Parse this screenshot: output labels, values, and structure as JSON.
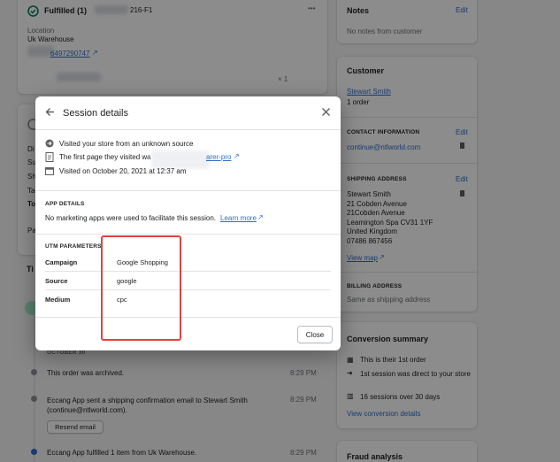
{
  "background": {
    "fulfilled": {
      "title": "Fulfilled (1)",
      "order_suffix": "216-F1",
      "location_label": "Location",
      "location_value": "Uk Warehouse",
      "tracking": "6497290747",
      "qty": "× 1",
      "more": "•••"
    },
    "left_partial_labels": [
      "Di",
      "Su",
      "Sh",
      "Ta",
      "To",
      "Pa"
    ],
    "timeline_heading_partial": "Ti",
    "timeline": {
      "date": "OCTOBER 30",
      "events": [
        {
          "text": "This order was archived.",
          "time": "8:29 PM"
        },
        {
          "text": "Eccang App sent a shipping confirmation email to Stewart Smith (continue@ntlworld.com).",
          "time": "8:29 PM"
        },
        {
          "text": "Eccang App fulfilled 1 item from Uk Warehouse.",
          "time": "8:29 PM"
        }
      ],
      "resend_button": "Resend email"
    },
    "notes": {
      "title": "Notes",
      "edit": "Edit",
      "empty": "No notes from customer"
    },
    "customer": {
      "title": "Customer",
      "name": "Stewart Smith",
      "orders": "1 order",
      "contact_header": "CONTACT INFORMATION",
      "contact_edit": "Edit",
      "email": "continue@ntlworld.com",
      "shipping_header": "SHIPPING ADDRESS",
      "shipping_edit": "Edit",
      "address": [
        "Stewart Smith",
        "21 Cobden Avenue",
        "21Cobden Avenue",
        "Leamington Spa CV31 1YF",
        "United Kingdom",
        "07486 867456"
      ],
      "view_map": "View map",
      "billing_header": "BILLING ADDRESS",
      "billing_value": "Same as shipping address"
    },
    "conversion": {
      "title": "Conversion summary",
      "items": [
        "This is their 1st order",
        "1st session was direct to your store",
        "16 sessions over 30 days"
      ],
      "link": "View conversion details"
    },
    "fraud": {
      "title": "Fraud analysis"
    }
  },
  "modal": {
    "title": "Session details",
    "visit_source": "Visited your store from an unknown source",
    "first_page_prefix": "The first page they visited wa",
    "first_page_suffix": "arer-pro",
    "visited_on": "Visited on October 20, 2021 at 12:37 am",
    "app_details_header": "APP DETAILS",
    "app_details_text": "No marketing apps were used to facilitate this session.",
    "learn_more": "Learn more",
    "utm_header": "UTM PARAMETERS",
    "utm": [
      {
        "key": "Campaign",
        "value": "Google Shopping"
      },
      {
        "key": "Source",
        "value": "google"
      },
      {
        "key": "Medium",
        "value": "cpc"
      }
    ],
    "close_button": "Close"
  },
  "colors": {
    "link": "#2c6ecb",
    "highlight": "#e0443e",
    "overlay": "rgba(0,0,0,0.45)"
  }
}
